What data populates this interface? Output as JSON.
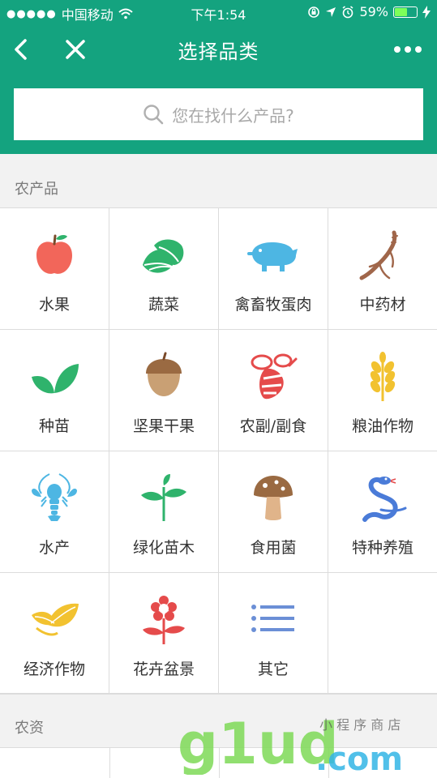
{
  "status_bar": {
    "carrier": "中国移动",
    "time": "下午1:54",
    "battery": "59%",
    "battery_level": 0.59
  },
  "nav": {
    "title": "选择品类",
    "back_icon": "chevron-left-icon",
    "close_icon": "close-icon",
    "more_icon": "more-horizontal-icon"
  },
  "search": {
    "placeholder": "您在找什么产品?"
  },
  "sections": [
    {
      "label": "农产品"
    },
    {
      "label": "农资"
    }
  ],
  "categories": [
    {
      "label": "水果",
      "icon": "apple-icon",
      "color": "#f2665a"
    },
    {
      "label": "蔬菜",
      "icon": "vegetable-icon",
      "color": "#2fb36c"
    },
    {
      "label": "禽畜牧蛋肉",
      "icon": "pig-icon",
      "color": "#4db6e3"
    },
    {
      "label": "中药材",
      "icon": "ginseng-icon",
      "color": "#a0664a"
    },
    {
      "label": "种苗",
      "icon": "seedling-icon",
      "color": "#2fb36c"
    },
    {
      "label": "坚果干果",
      "icon": "acorn-icon",
      "color": "#b5845a"
    },
    {
      "label": "农副/副食",
      "icon": "bee-icon",
      "color": "#e54b4b"
    },
    {
      "label": "粮油作物",
      "icon": "wheat-icon",
      "color": "#f2c230"
    },
    {
      "label": "水产",
      "icon": "lobster-icon",
      "color": "#4db6e3"
    },
    {
      "label": "绿化苗木",
      "icon": "sapling-icon",
      "color": "#2fb36c"
    },
    {
      "label": "食用菌",
      "icon": "mushroom-icon",
      "color": "#a0664a"
    },
    {
      "label": "特种养殖",
      "icon": "snake-icon",
      "color": "#4a7bd8"
    },
    {
      "label": "经济作物",
      "icon": "tea-leaf-icon",
      "color": "#f2c230"
    },
    {
      "label": "花卉盆景",
      "icon": "flower-icon",
      "color": "#e54b4b"
    },
    {
      "label": "其它",
      "icon": "list-icon",
      "color": "#6b8fd6"
    }
  ],
  "colors": {
    "brand": "#14a37f",
    "background": "#f2f2f2",
    "divider": "#dcdcdc",
    "text": "#333333",
    "muted": "#7a7a7a"
  }
}
